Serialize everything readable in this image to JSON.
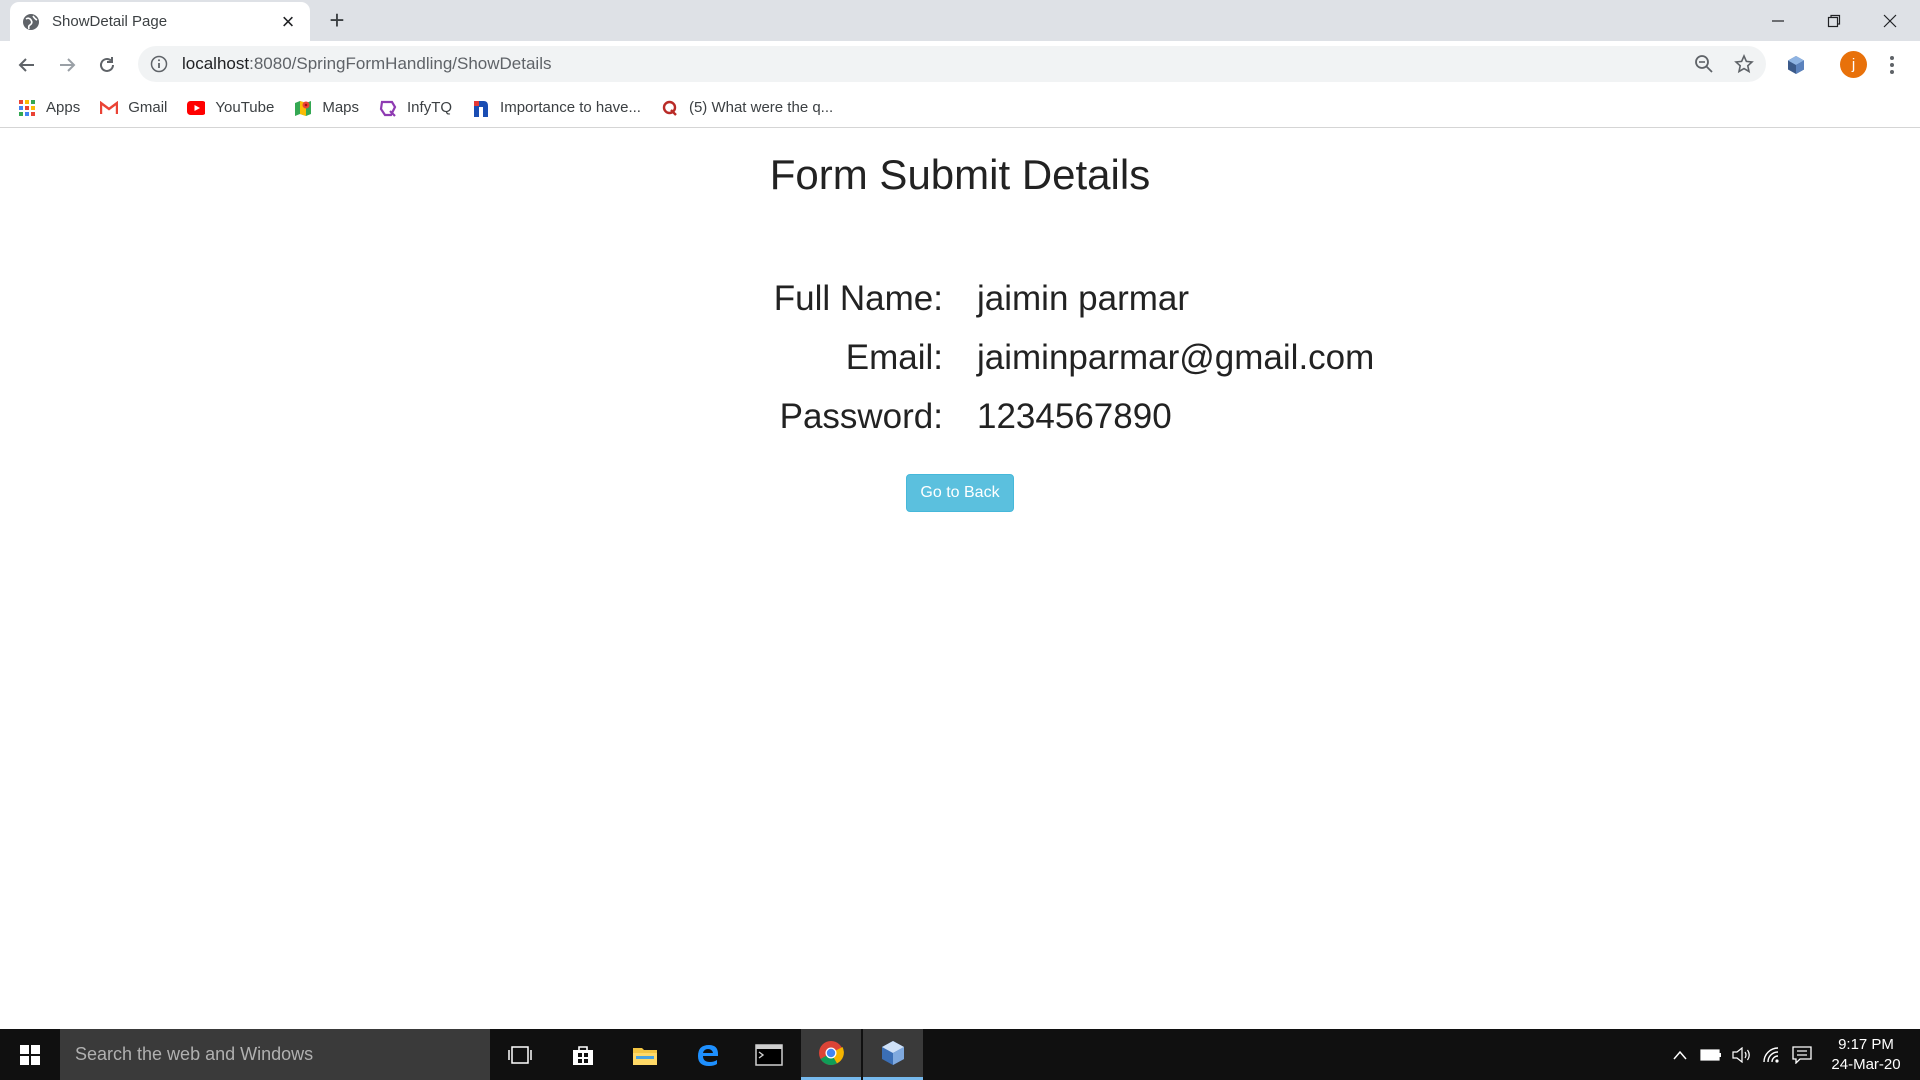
{
  "browser": {
    "tab_title": "ShowDetail Page",
    "url_host": "localhost",
    "url_rest": ":8080/SpringFormHandling/ShowDetails",
    "profile_initial": "j"
  },
  "bookmarks": [
    {
      "label": "Apps",
      "icon": "apps-grid-icon"
    },
    {
      "label": "Gmail",
      "icon": "gmail-icon"
    },
    {
      "label": "YouTube",
      "icon": "youtube-icon"
    },
    {
      "label": "Maps",
      "icon": "maps-icon"
    },
    {
      "label": "InfyTQ",
      "icon": "infytq-icon"
    },
    {
      "label": "Importance to have...",
      "icon": "bookmark-n-icon"
    },
    {
      "label": "(5) What were the q...",
      "icon": "quora-icon"
    }
  ],
  "page": {
    "title": "Form Submit Details",
    "fields": [
      {
        "label": "Full Name:",
        "value": "jaimin parmar"
      },
      {
        "label": "Email:",
        "value": "jaiminparmar@gmail.com"
      },
      {
        "label": "Password:",
        "value": "1234567890"
      }
    ],
    "back_button": "Go to Back"
  },
  "taskbar": {
    "search_placeholder": "Search the web and Windows",
    "time": "9:17 PM",
    "date": "24-Mar-20"
  },
  "colors": {
    "button_bg": "#5bc0de",
    "tabstrip_bg": "#dee1e6",
    "taskbar_bg": "#101010",
    "avatar_bg": "#e8710a"
  }
}
